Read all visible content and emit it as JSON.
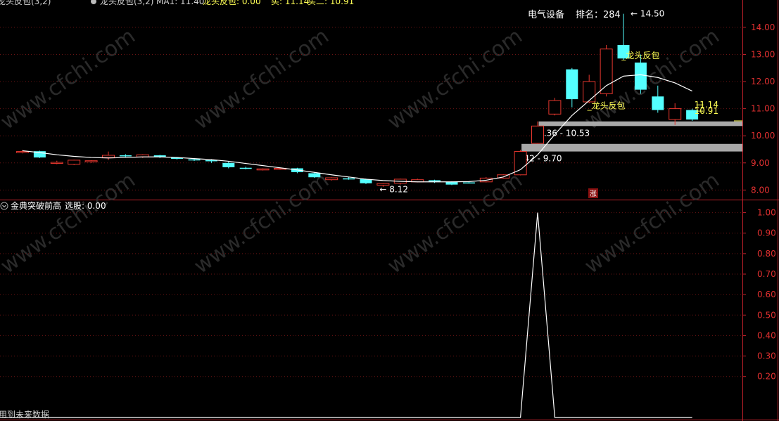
{
  "header": {
    "indicator_title": "龙头反包(3,2)",
    "ma_label": "MA1: 11.40",
    "signal_label": "龙头反包: 0.00",
    "sell_label": "买: 11.14",
    "buy_label": "买二: 10.91"
  },
  "info": {
    "sector": "电气设备",
    "rank_label": "排名：",
    "rank_value": "284"
  },
  "lower_panel": {
    "title": "金典突破前高",
    "select_label": "选股: 0.00"
  },
  "footer_note": "用到未来数据",
  "zt_badge": "涨",
  "watermark": "www.cfchi.com",
  "colors": {
    "up": "#e8372e",
    "down": "#54ffff",
    "ma": "#ffffff",
    "axis": "#c0212a",
    "grid": "#6b1414",
    "label_yellow": "#ffff55",
    "band": "#a8a8a8"
  },
  "chart_data": [
    {
      "type": "candlestick",
      "ylim": [
        7.75,
        14.8
      ],
      "y_ticks": [
        "14.00",
        "13.00",
        "12.00",
        "11.00",
        "10.00",
        "9.00",
        "8.00"
      ],
      "candles": [
        {
          "o": 9.4,
          "h": 9.48,
          "l": 9.35,
          "c": 9.42
        },
        {
          "o": 9.43,
          "h": 9.45,
          "l": 9.18,
          "c": 9.2
        },
        {
          "o": 8.98,
          "h": 9.08,
          "l": 8.95,
          "c": 9.02
        },
        {
          "o": 8.95,
          "h": 9.12,
          "l": 8.92,
          "c": 9.1
        },
        {
          "o": 9.05,
          "h": 9.1,
          "l": 9.0,
          "c": 9.08
        },
        {
          "o": 9.2,
          "h": 9.42,
          "l": 9.1,
          "c": 9.28
        },
        {
          "o": 9.28,
          "h": 9.32,
          "l": 9.22,
          "c": 9.24
        },
        {
          "o": 9.22,
          "h": 9.32,
          "l": 9.18,
          "c": 9.3
        },
        {
          "o": 9.28,
          "h": 9.3,
          "l": 9.18,
          "c": 9.22
        },
        {
          "o": 9.2,
          "h": 9.22,
          "l": 9.12,
          "c": 9.15
        },
        {
          "o": 9.13,
          "h": 9.16,
          "l": 9.07,
          "c": 9.1
        },
        {
          "o": 9.1,
          "h": 9.14,
          "l": 9.0,
          "c": 9.06
        },
        {
          "o": 9.0,
          "h": 9.04,
          "l": 8.8,
          "c": 8.84
        },
        {
          "o": 8.82,
          "h": 8.86,
          "l": 8.76,
          "c": 8.78
        },
        {
          "o": 8.74,
          "h": 8.8,
          "l": 8.72,
          "c": 8.78
        },
        {
          "o": 8.78,
          "h": 8.82,
          "l": 8.74,
          "c": 8.8
        },
        {
          "o": 8.8,
          "h": 8.82,
          "l": 8.62,
          "c": 8.66
        },
        {
          "o": 8.62,
          "h": 8.64,
          "l": 8.45,
          "c": 8.47
        },
        {
          "o": 8.38,
          "h": 8.47,
          "l": 8.35,
          "c": 8.45
        },
        {
          "o": 8.43,
          "h": 8.48,
          "l": 8.38,
          "c": 8.4
        },
        {
          "o": 8.4,
          "h": 8.42,
          "l": 8.22,
          "c": 8.25
        },
        {
          "o": 8.18,
          "h": 8.26,
          "l": 8.12,
          "c": 8.24
        },
        {
          "o": 8.25,
          "h": 8.42,
          "l": 8.2,
          "c": 8.4
        },
        {
          "o": 8.3,
          "h": 8.42,
          "l": 8.28,
          "c": 8.38
        },
        {
          "o": 8.36,
          "h": 8.38,
          "l": 8.26,
          "c": 8.3
        },
        {
          "o": 8.3,
          "h": 8.32,
          "l": 8.18,
          "c": 8.2
        },
        {
          "o": 8.28,
          "h": 8.32,
          "l": 8.24,
          "c": 8.26
        },
        {
          "o": 8.3,
          "h": 8.48,
          "l": 8.28,
          "c": 8.44
        },
        {
          "o": 8.44,
          "h": 8.58,
          "l": 8.42,
          "c": 8.56
        },
        {
          "o": 8.56,
          "h": 9.48,
          "l": 8.54,
          "c": 9.42
        },
        {
          "o": 9.72,
          "h": 10.53,
          "l": 9.7,
          "c": 10.36
        },
        {
          "o": 10.8,
          "h": 11.4,
          "l": 10.75,
          "c": 11.3
        },
        {
          "o": 12.45,
          "h": 12.5,
          "l": 11.05,
          "c": 11.35
        },
        {
          "o": 11.25,
          "h": 12.25,
          "l": 11.2,
          "c": 12.0
        },
        {
          "o": 11.55,
          "h": 13.35,
          "l": 11.45,
          "c": 13.2
        },
        {
          "o": 13.35,
          "h": 14.5,
          "l": 12.8,
          "c": 12.85
        },
        {
          "o": 12.7,
          "h": 13.0,
          "l": 11.55,
          "c": 11.7
        },
        {
          "o": 11.45,
          "h": 11.85,
          "l": 10.85,
          "c": 10.95
        },
        {
          "o": 10.6,
          "h": 11.2,
          "l": 10.4,
          "c": 11.0
        },
        {
          "o": 10.95,
          "h": 11.0,
          "l": 10.55,
          "c": 10.6
        }
      ],
      "ma": [
        9.45,
        9.38,
        9.3,
        9.24,
        9.2,
        9.18,
        9.2,
        9.22,
        9.22,
        9.2,
        9.16,
        9.12,
        9.06,
        8.98,
        8.9,
        8.82,
        8.74,
        8.65,
        8.56,
        8.48,
        8.4,
        8.35,
        8.32,
        8.3,
        8.3,
        8.3,
        8.31,
        8.36,
        8.48,
        8.75,
        9.3,
        10.05,
        10.75,
        11.3,
        11.85,
        12.2,
        12.25,
        12.15,
        11.95,
        11.65
      ],
      "annotations": [
        {
          "text": "14.50",
          "x_index": 35,
          "y": 14.5
        },
        {
          "text": "8.12",
          "x_index": 21,
          "y": 8.12
        },
        {
          "text": "11.14",
          "x_index": 39,
          "y": 11.14
        },
        {
          "text": "10.91",
          "x_index": 39,
          "y": 10.91
        }
      ],
      "signal_labels": [
        "龙头反包",
        "龙头反包"
      ],
      "bands": [
        {
          "label": "10.36 - 10.53",
          "low": 10.36,
          "high": 10.53,
          "from_index": 30
        },
        {
          "label": "9.42 - 9.70",
          "low": 9.42,
          "high": 9.7,
          "from_index": 29
        }
      ]
    },
    {
      "type": "line",
      "ylim": [
        0,
        1.05
      ],
      "y_ticks": [
        "1.00",
        "0.90",
        "0.80",
        "0.70",
        "0.60",
        "0.50",
        "0.40",
        "0.30",
        "0.20"
      ],
      "values": [
        0,
        0,
        0,
        0,
        0,
        0,
        0,
        0,
        0,
        0,
        0,
        0,
        0,
        0,
        0,
        0,
        0,
        0,
        0,
        0,
        0,
        0,
        0,
        0,
        0,
        0,
        0,
        0,
        0,
        0,
        1,
        0,
        0,
        0,
        0,
        0,
        0,
        0,
        0,
        0
      ]
    }
  ]
}
